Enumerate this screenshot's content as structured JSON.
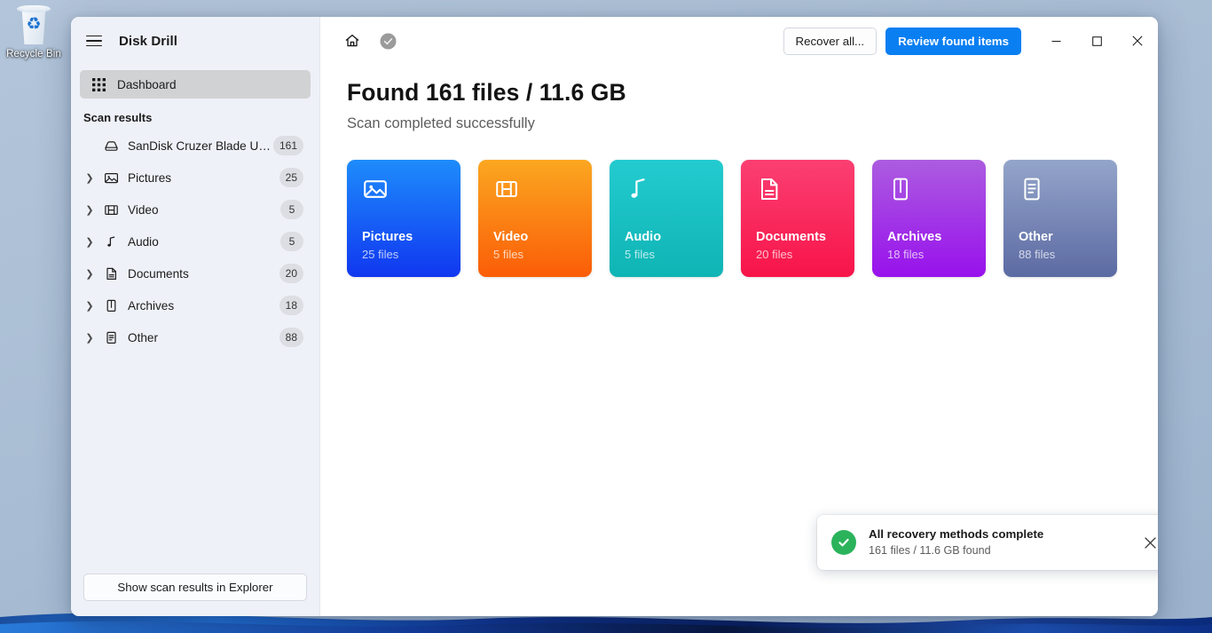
{
  "desktop": {
    "recycle_bin_label": "Recycle Bin"
  },
  "sidebar": {
    "menu_icon": "hamburger-menu-icon",
    "app_title": "Disk Drill",
    "nav": [
      {
        "label": "Dashboard",
        "icon": "grid-icon",
        "selected": true
      }
    ],
    "section_title": "Scan results",
    "tree": [
      {
        "label": "SanDisk Cruzer Blade US...",
        "count": "161",
        "icon": "disk-icon",
        "expandable": false
      },
      {
        "label": "Pictures",
        "count": "25",
        "icon": "image-icon",
        "expandable": true
      },
      {
        "label": "Video",
        "count": "5",
        "icon": "film-icon",
        "expandable": true
      },
      {
        "label": "Audio",
        "count": "5",
        "icon": "music-icon",
        "expandable": true
      },
      {
        "label": "Documents",
        "count": "20",
        "icon": "document-icon",
        "expandable": true
      },
      {
        "label": "Archives",
        "count": "18",
        "icon": "archive-icon",
        "expandable": true
      },
      {
        "label": "Other",
        "count": "88",
        "icon": "file-icon",
        "expandable": true
      }
    ],
    "footer_button": "Show scan results in Explorer"
  },
  "titlebar": {
    "home_icon": "home-icon",
    "status_icon": "check-circle-icon",
    "recover_all_label": "Recover all...",
    "review_label": "Review found items",
    "minimize_icon": "minimize-icon",
    "maximize_icon": "maximize-icon",
    "close_icon": "close-icon"
  },
  "main": {
    "title": "Found 161 files / 11.6 GB",
    "subtitle": "Scan completed successfully",
    "cards": [
      {
        "name": "Pictures",
        "count": "25 files",
        "icon": "image-icon",
        "color_from": "#1e8cfb",
        "color_to": "#1037f0"
      },
      {
        "name": "Video",
        "count": "5 files",
        "icon": "film-icon",
        "color_from": "#fba721",
        "color_to": "#fb5d07"
      },
      {
        "name": "Audio",
        "count": "5 files",
        "icon": "music-icon",
        "color_from": "#23cbd0",
        "color_to": "#0fb4b4"
      },
      {
        "name": "Documents",
        "count": "20 files",
        "icon": "document-icon",
        "color_from": "#fb3f72",
        "color_to": "#f71449"
      },
      {
        "name": "Archives",
        "count": "18 files",
        "icon": "archive-icon",
        "color_from": "#ac5ce0",
        "color_to": "#9811ec"
      },
      {
        "name": "Other",
        "count": "88 files",
        "icon": "file-icon",
        "color_from": "#94a5ca",
        "color_to": "#5c6aa3"
      }
    ]
  },
  "toast": {
    "icon": "check-circle-icon",
    "title": "All recovery methods complete",
    "subtitle": "161 files / 11.6 GB found",
    "close_icon": "close-icon"
  },
  "colors": {
    "accent": "#0a7ff2",
    "sidebar_bg": "#eef1f7",
    "success": "#2bb35c"
  }
}
